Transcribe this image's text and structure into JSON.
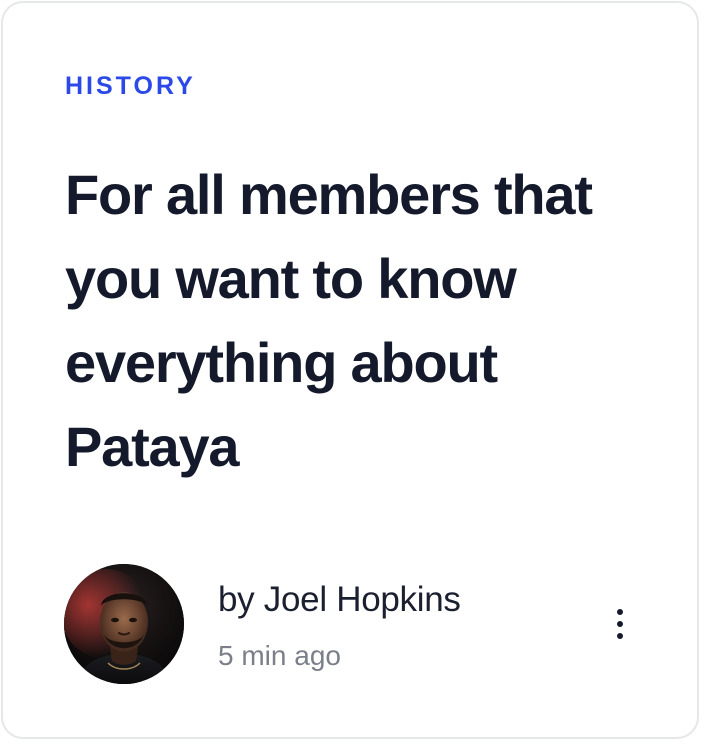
{
  "card": {
    "category": "HISTORY",
    "title": "For all members that you want to know everything about Pataya",
    "author": "by Joel Hopkins",
    "time": "5 min ago"
  },
  "icons": {
    "avatar": "author-photo",
    "more": "more-vertical-icon"
  },
  "colors": {
    "accent": "#2b48e8",
    "title": "#141a2b",
    "muted": "#7a7f89",
    "border": "#e6e7ea"
  }
}
